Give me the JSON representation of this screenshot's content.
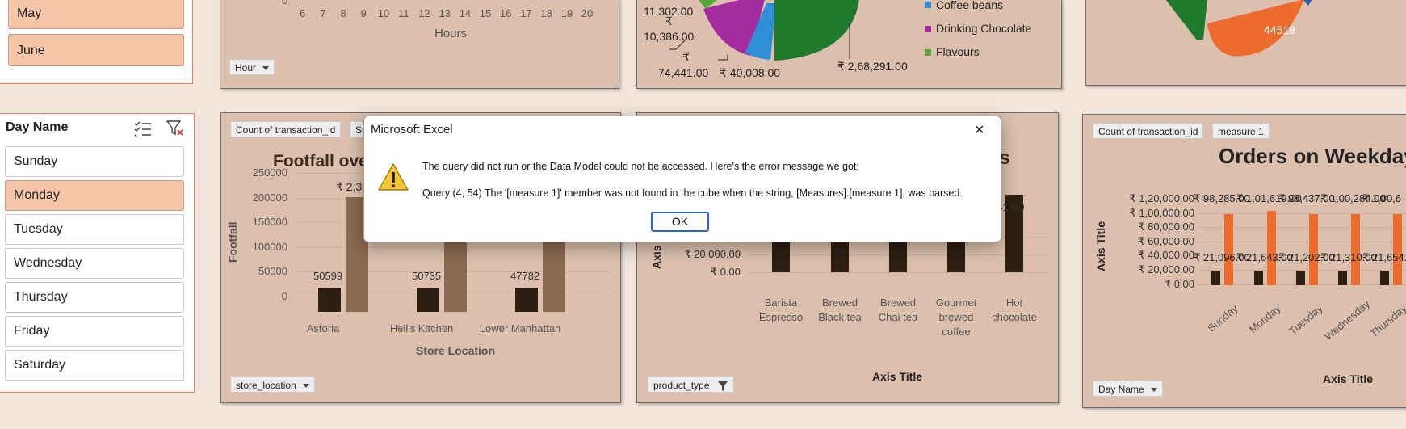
{
  "month_slicer": {
    "items": [
      {
        "label": "May"
      },
      {
        "label": "June"
      }
    ]
  },
  "day_slicer": {
    "title": "Day Name",
    "items": [
      {
        "label": "Sunday",
        "selected": false
      },
      {
        "label": "Monday",
        "selected": true
      },
      {
        "label": "Tuesday",
        "selected": false
      },
      {
        "label": "Wednesday",
        "selected": false
      },
      {
        "label": "Thursday",
        "selected": false
      },
      {
        "label": "Friday",
        "selected": false
      },
      {
        "label": "Saturday",
        "selected": false
      }
    ]
  },
  "hour_chart": {
    "xticks": [
      "6",
      "7",
      "8",
      "9",
      "10",
      "11",
      "12",
      "13",
      "14",
      "15",
      "16",
      "17",
      "18",
      "19",
      "20"
    ],
    "xlabel": "Hours",
    "field_button": "Hour",
    "partial_tick": "0"
  },
  "pie_chart": {
    "labels": [
      "11,302.00",
      "₹",
      "10,386.00",
      "₹",
      "74,441.00",
      "₹ 40,008.00",
      "₹ 2,68,291.00"
    ],
    "legend": [
      {
        "label": "Coffee beans",
        "color": "#2e8fd6"
      },
      {
        "label": "Drinking Chocolate",
        "color": "#a42ca0"
      },
      {
        "label": "Flavours",
        "color": "#55a83a"
      }
    ]
  },
  "pie2": {
    "label": "44518"
  },
  "footfall": {
    "field_buttons": [
      "Count of transaction_id",
      "Su"
    ],
    "title": "Footfall ove",
    "ylabel": "Footfall",
    "xlabel": "Store Location",
    "yticks": [
      "250000",
      "200000",
      "150000",
      "100000",
      "50000",
      "0"
    ],
    "bar_labels": [
      "50599",
      "50735",
      "47782"
    ],
    "partial_top_label": "₹ 2,31",
    "field_button_bottom": "store_location"
  },
  "product": {
    "title_partial": "es",
    "yticks": [
      "₹ 40,000.00",
      "₹ 20,000.00",
      "₹ 0.00"
    ],
    "ylabel_partial": "Axis T",
    "xlabel": "Axis Title",
    "field_button": "product_type",
    "categories": [
      "Barista Espresso",
      "Brewed Black tea",
      "Brewed Chai tea",
      "Gourmet brewed coffee",
      "Hot chocolate"
    ],
    "top_label_partial": "4,441.00"
  },
  "weekday": {
    "field_buttons": [
      "Count of transaction_id",
      "measure 1"
    ],
    "title": "Orders on Weekday",
    "ylabel": "Axis Title",
    "xlabel": "Axis Title",
    "field_button": "Day Name",
    "yticks": [
      "₹ 1,20,000.00",
      "₹ 1,00,000.00",
      "₹ 80,000.00",
      "₹ 60,000.00",
      "₹ 40,000.00",
      "₹ 20,000.00",
      "₹ 0.00"
    ],
    "categories": [
      "Sunday",
      "Monday",
      "Tuesday",
      "Wednesday",
      "Thursday"
    ],
    "top_labels": [
      "₹ 98,285.00",
      "₹ 1,01,619.00",
      "₹ 98,437.00",
      "₹ 1,00,284.00",
      "₹ 1,00,6"
    ],
    "low_labels": [
      "₹ 21,096.00",
      "₹ 21,643.00",
      "₹ 21,202.00",
      "₹ 21,310.00",
      "₹ 21,654.0"
    ]
  },
  "dialog": {
    "title": "Microsoft Excel",
    "message1": "The query did not run or the Data Model could not be accessed. Here's the error message we got:",
    "message2": "Query (4, 54) The '[measure 1]' member was not found in the cube when the string, [Measures].[measure 1], was parsed.",
    "ok": "OK",
    "close": "✕"
  }
}
